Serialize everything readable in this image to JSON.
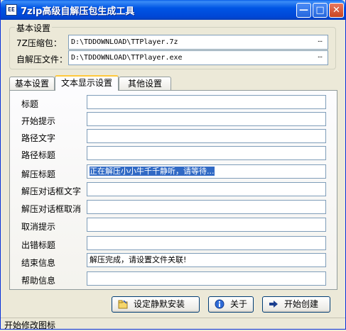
{
  "window": {
    "title": "7zip高级自解压包生成工具",
    "icon_text": "EE",
    "minimize_glyph": "—",
    "maximize_glyph": "□",
    "close_glyph": "✕"
  },
  "basic_group": {
    "legend": "基本设置",
    "archive_label": "7Z压缩包：",
    "archive_value": "D:\\TDDOWNLOAD\\TTPlayer.7z",
    "sfx_label": "自解压文件：",
    "sfx_value": "D:\\TDDOWNLOAD\\TTPlayer.exe",
    "browse_label": "..."
  },
  "tabs": [
    {
      "label": "基本设置"
    },
    {
      "label": "文本显示设置"
    },
    {
      "label": "其他设置"
    }
  ],
  "form": {
    "fields": [
      {
        "label": "标题",
        "value": ""
      },
      {
        "label": "开始提示",
        "value": ""
      },
      {
        "label": "路径文字",
        "value": ""
      },
      {
        "label": "路径标题",
        "value": ""
      },
      {
        "label": "解压标题",
        "value": "正在解压小小牛千千静听，请等待..."
      },
      {
        "label": "解压对话框文字",
        "value": ""
      },
      {
        "label": "解压对话框取消",
        "value": ""
      },
      {
        "label": "取消提示",
        "value": ""
      },
      {
        "label": "出错标题",
        "value": ""
      },
      {
        "label": "结束信息",
        "value": "解压完成，请设置文件关联!"
      },
      {
        "label": "帮助信息",
        "value": ""
      }
    ]
  },
  "buttons": {
    "silent_install": "设定静默安装",
    "about": "关于",
    "start_create": "开始创建"
  },
  "status": {
    "text": "开始修改图标"
  },
  "colors": {
    "titlebar": "#0055e5",
    "selection": "#316ac5",
    "window_bg": "#ece9d8",
    "active_tab_accent": "#ffc83c"
  }
}
